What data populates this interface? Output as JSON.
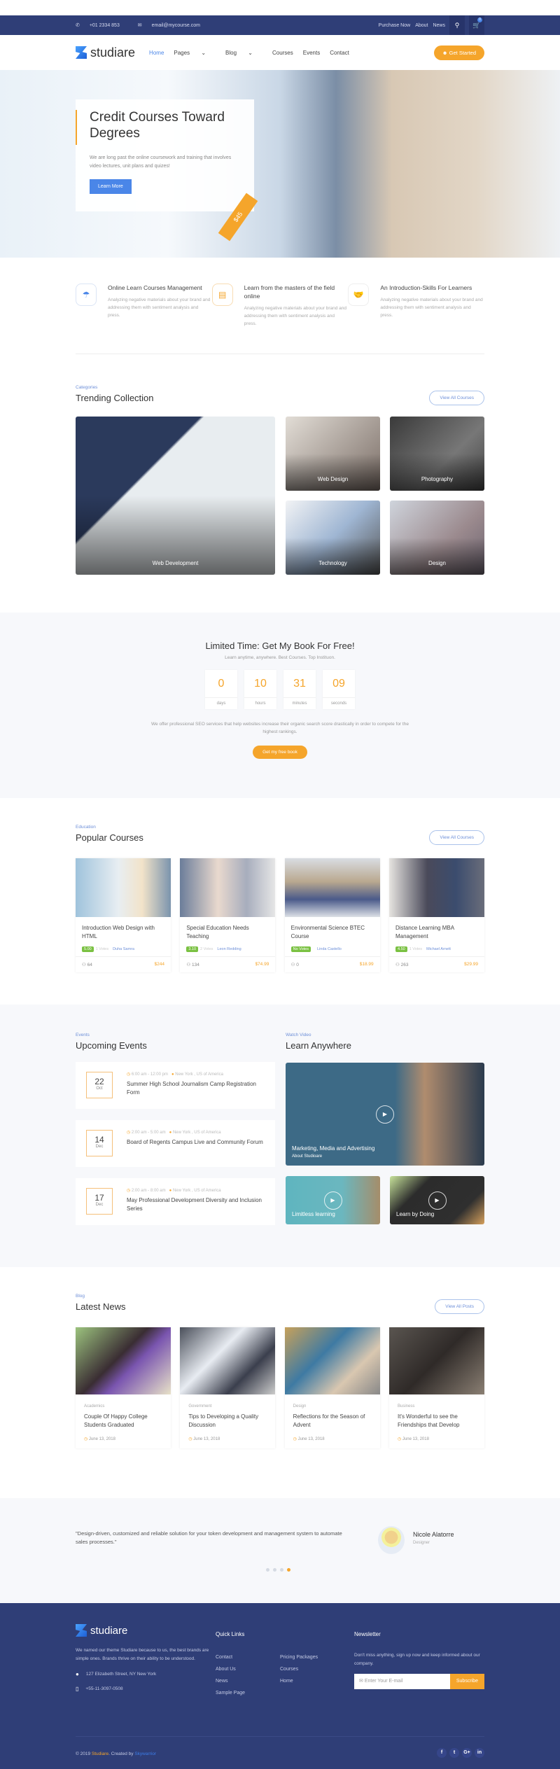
{
  "topbar": {
    "phone": "+01 2334 853",
    "email": "email@mycourse.com",
    "links": [
      "Purchase Now",
      "About",
      "News"
    ],
    "cart_count": "0"
  },
  "header": {
    "logo": "studiare",
    "nav": [
      "Home",
      "Pages",
      "Blog",
      "Courses",
      "Events",
      "Contact"
    ],
    "cta": "Get Started"
  },
  "hero": {
    "title": "Credit Courses Toward Degrees",
    "text": "We are long past the online coursework and training that involves video lectures, unit plans and quizes!",
    "button": "Learn More",
    "price": "$45"
  },
  "features": [
    {
      "icon": "umbrella-icon",
      "title": "Online Learn Courses Management",
      "text": "Analyzing negative materials about your brand and addressing them with sentiment analysis and press."
    },
    {
      "icon": "id-card-icon",
      "title": "Learn from the masters of the field online",
      "text": "Analyzing negative materials about your brand and addressing them with sentiment analysis and press."
    },
    {
      "icon": "handshake-icon",
      "title": "An Introduction-Skills For Learners",
      "text": "Analyzing negative materials about your brand and addressing them with sentiment analysis and press."
    }
  ],
  "trending": {
    "eyebrow": "Categories",
    "title": "Trending Collection",
    "button": "View All Courses",
    "tiles": [
      "Web Development",
      "Web Design",
      "Photography",
      "Technology",
      "Design"
    ]
  },
  "limited": {
    "title": "Limited Time: Get My Book For Free!",
    "subtitle": "Learn anytime, anywhere. Best Courses. Top Instituon.",
    "counters": [
      {
        "value": "0",
        "unit": "days"
      },
      {
        "value": "10",
        "unit": "hours"
      },
      {
        "value": "31",
        "unit": "minutes"
      },
      {
        "value": "09",
        "unit": "seconds"
      }
    ],
    "text": "We offer professional SEO services that help websites increase their organic search score drastically in order to compete for the highest rankings.",
    "button": "Get my free book"
  },
  "popular": {
    "eyebrow": "Education",
    "title": "Popular Courses",
    "button": "View All Courses",
    "courses": [
      {
        "title": "Introduction Web Design with HTML",
        "rating": "5.00",
        "votes": "1 Votes",
        "author": "Duha Samra",
        "students": "64",
        "price": "$244"
      },
      {
        "title": "Special Education Needs Teaching",
        "rating": "3.10",
        "votes": "2 Votes",
        "author": "Leon Redding",
        "students": "134",
        "price": "$74.99"
      },
      {
        "title": "Environmental Science BTEC Course",
        "rating": "No Votes",
        "votes": "",
        "author": "Linda Castello",
        "students": "0",
        "price": "$18.99"
      },
      {
        "title": "Distance Learning MBA Management",
        "rating": "4.50",
        "votes": "1 Votes",
        "author": "Michael Arnett",
        "students": "263",
        "price": "$29.99"
      }
    ]
  },
  "events": {
    "eyebrow": "Events",
    "title": "Upcoming Events",
    "items": [
      {
        "day": "22",
        "month": "Oct",
        "time": "6:00 am - 12:00 pm",
        "location": "New York , US of America",
        "title": "Summer High School Journalism Camp Registration Form"
      },
      {
        "day": "14",
        "month": "Dec",
        "time": "2:00 am - 5:00 am",
        "location": "New York , US of America",
        "title": "Board of Regents Campus Live and Community Forum"
      },
      {
        "day": "17",
        "month": "Dec",
        "time": "2:00 am - 8:00 am",
        "location": "New York , US of America",
        "title": "May Professional Development Diversity and Inclusion Series"
      }
    ]
  },
  "videos": {
    "eyebrow": "Watch Video",
    "title": "Learn Anywhere",
    "main": {
      "title": "Marketing, Media and Advertising",
      "subtitle": "About Studioare"
    },
    "small": [
      "Limitless learning",
      "Learn by Doing"
    ]
  },
  "news": {
    "eyebrow": "Blog",
    "title": "Latest News",
    "button": "View All Posts",
    "posts": [
      {
        "category": "Academics",
        "title": "Couple Of Happy College Students Graduated",
        "date": "June 13, 2018"
      },
      {
        "category": "Government",
        "title": "Tips to Developing a Quality Discussion",
        "date": "June 13, 2018"
      },
      {
        "category": "Design",
        "title": "Reflections for the Season of Advent",
        "date": "June 13, 2018"
      },
      {
        "category": "Business",
        "title": "It's Wonderful to see the Friendships that Develop",
        "date": "June 13, 2018"
      }
    ]
  },
  "testimonial": {
    "quote": "\"Design-driven, customized and reliable solution for your token development and management system to automate sales processes.\"",
    "name": "Nicole Alatorre",
    "role": "Designer",
    "active_slide": 4,
    "slides": 4
  },
  "footer": {
    "logo": "studiare",
    "about": "We named our theme Studiare because to us, the best brands are simple ones. Brands thrive on their ability to be understood.",
    "address": "127 Elizabeth Street, NY New York",
    "phone": "+55-11-3097-0508",
    "quick_title": "Quick Links",
    "links_col1": [
      "Contact",
      "About Us",
      "News",
      "Sample Page"
    ],
    "links_col2": [
      "Pricing Packages",
      "Courses",
      "Home"
    ],
    "newsletter_title": "Newsletter",
    "newsletter_text": "Don't miss anything, sign up now and keep informed about our company.",
    "email_placeholder": "Enter Your E-mail",
    "subscribe": "Subscribe",
    "copyright": "© 2019",
    "brand": "Studiare",
    "created_by": ". Created by",
    "author": "Skywarrior"
  },
  "colors": {
    "navy": "#2f3e77",
    "accent_orange": "#f5a52b",
    "accent_blue": "#4a86e8",
    "rating_green": "#7ac142"
  }
}
